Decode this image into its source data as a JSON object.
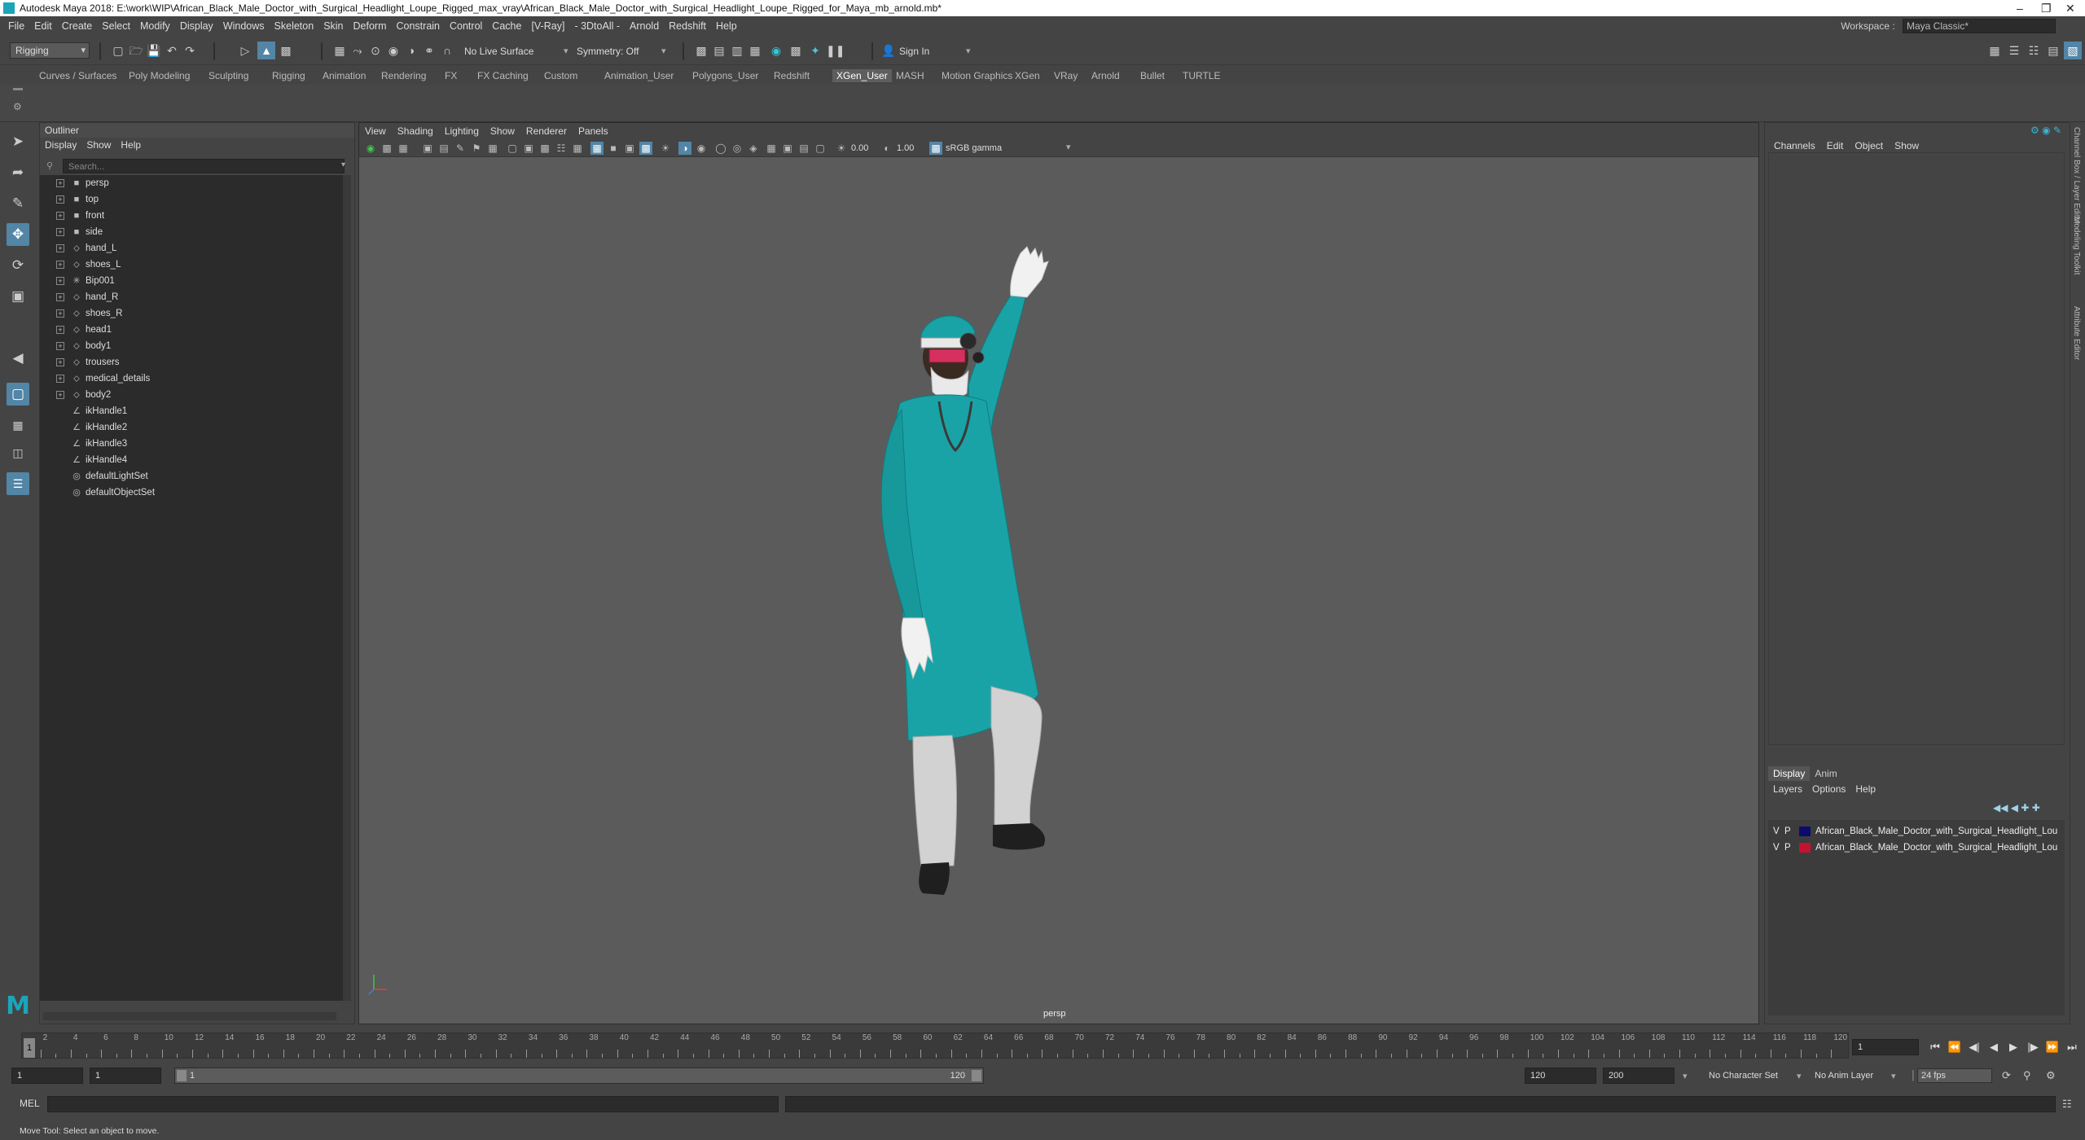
{
  "window": {
    "title": "Autodesk Maya 2018: E:\\work\\WIP\\African_Black_Male_Doctor_with_Surgical_Headlight_Loupe_Rigged_max_vray\\African_Black_Male_Doctor_with_Surgical_Headlight_Loupe_Rigged_for_Maya_mb_arnold.mb*",
    "minimize": "–",
    "restore": "❐",
    "close": "✕"
  },
  "menubar": {
    "items": [
      "File",
      "Edit",
      "Create",
      "Select",
      "Modify",
      "Display",
      "Windows",
      "Skeleton",
      "Skin",
      "Deform",
      "Constrain",
      "Control",
      "Cache",
      "[V-Ray]",
      "- 3DtoAll -",
      "Arnold",
      "Redshift",
      "Help"
    ],
    "workspace_label": "Workspace :",
    "workspace_value": "Maya Classic*"
  },
  "statusline": {
    "menuset": "Rigging",
    "live_surface": "No Live Surface",
    "symmetry": "Symmetry: Off",
    "sign_in": "Sign In"
  },
  "shelf": {
    "tabs": [
      "Curves / Surfaces",
      "Poly Modeling",
      "Sculpting",
      "Rigging",
      "Animation",
      "Rendering",
      "FX",
      "FX Caching",
      "Custom",
      "Animation_User",
      "Polygons_User",
      "Redshift",
      "XGen_User",
      "MASH",
      "Motion Graphics",
      "XGen",
      "VRay",
      "Arnold",
      "Bullet",
      "TURTLE"
    ],
    "active": "XGen_User"
  },
  "outliner": {
    "title": "Outliner",
    "menu": [
      "Display",
      "Show",
      "Help"
    ],
    "search_placeholder": "Search...",
    "items": [
      {
        "label": "persp",
        "icon": "camera-icon",
        "expandable": true
      },
      {
        "label": "top",
        "icon": "camera-icon",
        "expandable": true
      },
      {
        "label": "front",
        "icon": "camera-icon",
        "expandable": true
      },
      {
        "label": "side",
        "icon": "camera-icon",
        "expandable": true
      },
      {
        "label": "hand_L",
        "icon": "transform-icon",
        "expandable": true
      },
      {
        "label": "shoes_L",
        "icon": "transform-icon",
        "expandable": true
      },
      {
        "label": "Bip001",
        "icon": "joint-icon",
        "expandable": true
      },
      {
        "label": "hand_R",
        "icon": "transform-icon",
        "expandable": true
      },
      {
        "label": "shoes_R",
        "icon": "transform-icon",
        "expandable": true
      },
      {
        "label": "head1",
        "icon": "transform-icon",
        "expandable": true
      },
      {
        "label": "body1",
        "icon": "transform-icon",
        "expandable": true
      },
      {
        "label": "trousers",
        "icon": "transform-icon",
        "expandable": true
      },
      {
        "label": "medical_details",
        "icon": "transform-icon",
        "expandable": true
      },
      {
        "label": "body2",
        "icon": "transform-icon",
        "expandable": true
      },
      {
        "label": "ikHandle1",
        "icon": "ik-handle-icon",
        "expandable": false
      },
      {
        "label": "ikHandle2",
        "icon": "ik-handle-icon",
        "expandable": false
      },
      {
        "label": "ikHandle3",
        "icon": "ik-handle-icon",
        "expandable": false
      },
      {
        "label": "ikHandle4",
        "icon": "ik-handle-icon",
        "expandable": false
      },
      {
        "label": "defaultLightSet",
        "icon": "set-icon",
        "expandable": false
      },
      {
        "label": "defaultObjectSet",
        "icon": "set-icon",
        "expandable": false
      }
    ]
  },
  "viewport": {
    "menu": [
      "View",
      "Shading",
      "Lighting",
      "Show",
      "Renderer",
      "Panels"
    ],
    "exposure": "0.00",
    "gamma": "1.00",
    "colorspace": "sRGB gamma",
    "camera": "persp"
  },
  "channelbox": {
    "menu": [
      "Channels",
      "Edit",
      "Object",
      "Show"
    ],
    "layer_tabs": [
      "Display",
      "Anim"
    ],
    "layer_menu": [
      "Layers",
      "Options",
      "Help"
    ],
    "layers": [
      {
        "v": "V",
        "p": "P",
        "color": "#0b0b6e",
        "name": "African_Black_Male_Doctor_with_Surgical_Headlight_Lou"
      },
      {
        "v": "V",
        "p": "P",
        "color": "#c41230",
        "name": "African_Black_Male_Doctor_with_Surgical_Headlight_Lou"
      }
    ],
    "side_tabs": [
      "Channel Box / Layer Editor",
      "Modeling Toolkit",
      "Attribute Editor"
    ]
  },
  "timeline": {
    "ticks": [
      2,
      4,
      6,
      8,
      10,
      12,
      14,
      16,
      18,
      20,
      22,
      24,
      26,
      28,
      30,
      32,
      34,
      36,
      38,
      40,
      42,
      44,
      46,
      48,
      50,
      52,
      54,
      56,
      58,
      60,
      62,
      64,
      66,
      68,
      70,
      72,
      74,
      76,
      78,
      80,
      82,
      84,
      86,
      88,
      90,
      92,
      94,
      96,
      98,
      100,
      102,
      104,
      106,
      108,
      110,
      112,
      114,
      116,
      118,
      120
    ],
    "current_marker": "1",
    "current_frame": "1"
  },
  "range": {
    "start": "1",
    "playback_start": "1",
    "slider_start": "1",
    "slider_end": "120",
    "playback_end": "120",
    "end": "200",
    "character_set": "No Character Set",
    "anim_layer": "No Anim Layer",
    "fps": "24 fps"
  },
  "command": {
    "label": "MEL"
  },
  "helpline": "Move Tool: Select an object to move.",
  "colors": {
    "accent": "#5285a6",
    "scrubs": "#15a0a8"
  }
}
